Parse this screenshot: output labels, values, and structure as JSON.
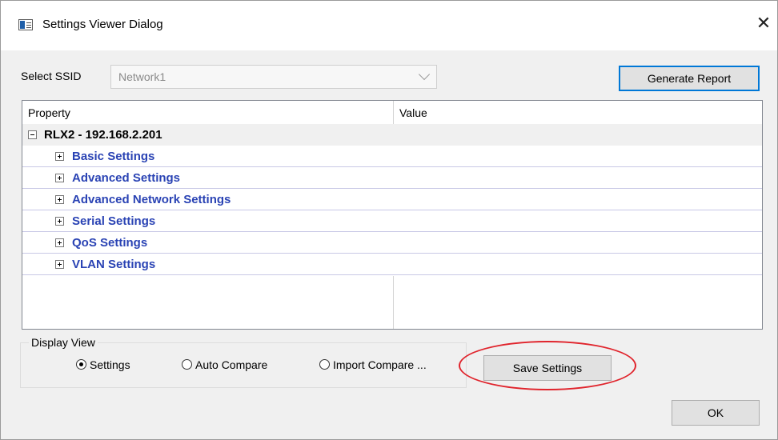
{
  "window": {
    "title": "Settings Viewer Dialog",
    "close_glyph": "✕"
  },
  "ssid": {
    "label": "Select SSID",
    "value": "Network1"
  },
  "buttons": {
    "generate_report": "Generate Report",
    "save_settings": "Save Settings",
    "ok": "OK"
  },
  "grid": {
    "columns": [
      "Property",
      "Value"
    ],
    "root": "RLX2  - 192.168.2.201",
    "categories": [
      "Basic Settings",
      "Advanced Settings",
      "Advanced Network Settings",
      "Serial Settings",
      "QoS Settings",
      "VLAN Settings"
    ]
  },
  "display_view": {
    "label": "Display View",
    "options": [
      "Settings",
      "Auto Compare",
      "Import Compare ..."
    ],
    "selected": "Settings"
  },
  "colors": {
    "category_text": "#2a43b4",
    "highlight_ellipse": "#e0242c",
    "focus_border": "#0078d7"
  }
}
